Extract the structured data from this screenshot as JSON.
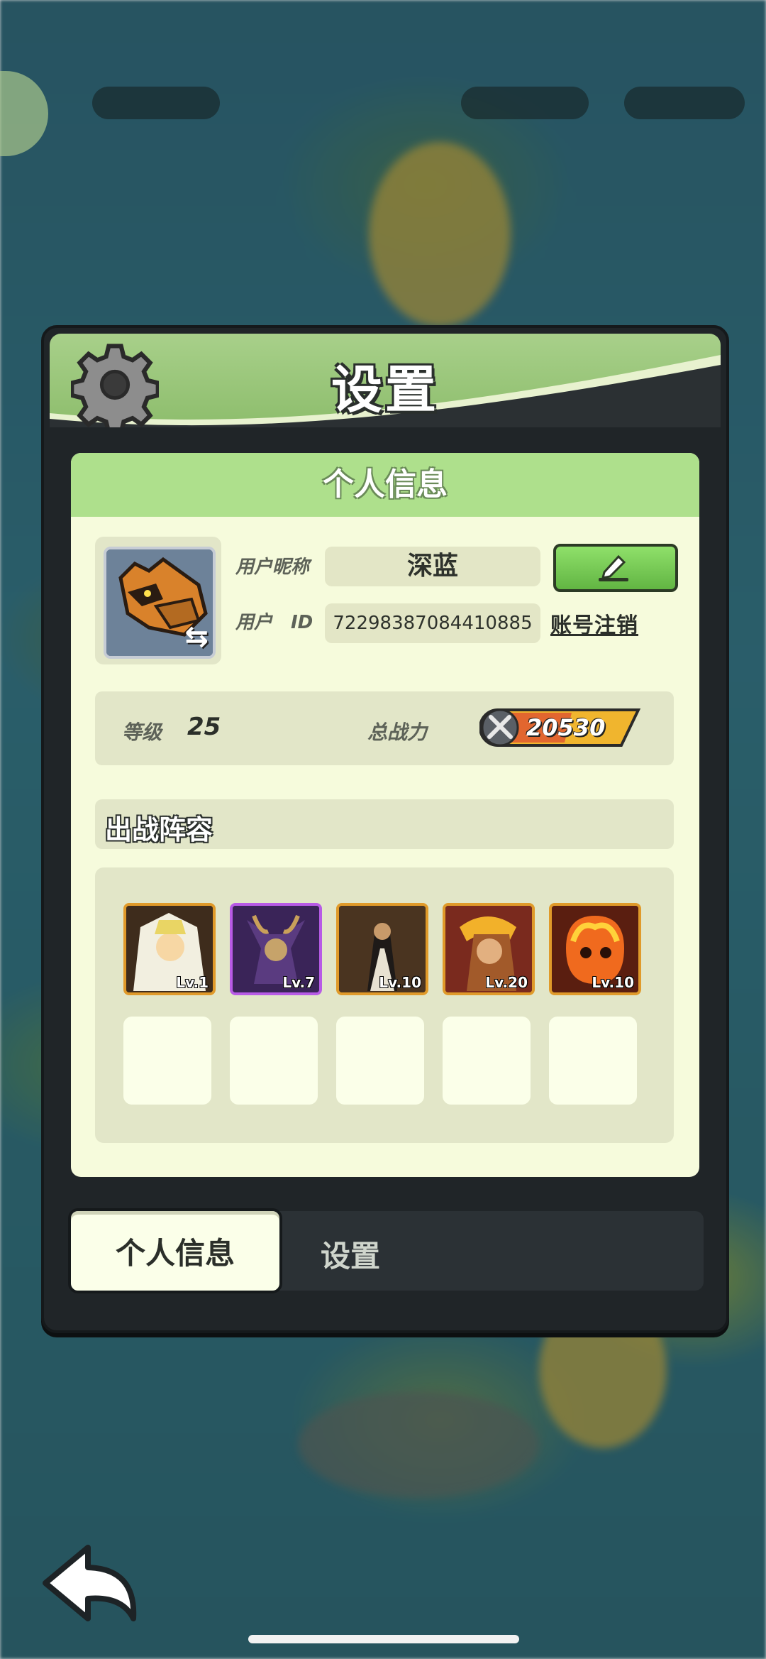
{
  "modal": {
    "title": "设置",
    "panel_title": "个人信息"
  },
  "profile": {
    "nickname_label": "用户昵称",
    "nickname": "深蓝",
    "id_label": "用户　ID",
    "user_id": "72298387084410885",
    "cancel_account": "账号注销"
  },
  "stats": {
    "level_label": "等级",
    "level": "25",
    "power_label": "总战力",
    "power": "20530"
  },
  "lineup": {
    "title": "出战阵容",
    "heroes": [
      {
        "level": "Lv.1"
      },
      {
        "level": "Lv.7"
      },
      {
        "level": "Lv.10"
      },
      {
        "level": "Lv.20"
      },
      {
        "level": "Lv.10"
      }
    ]
  },
  "tabs": {
    "profile": "个人信息",
    "settings": "设置"
  },
  "icons": [
    "gear-icon",
    "edit-pencil-icon",
    "swap-icon",
    "crossed-swords-icon",
    "back-arrow-icon"
  ]
}
